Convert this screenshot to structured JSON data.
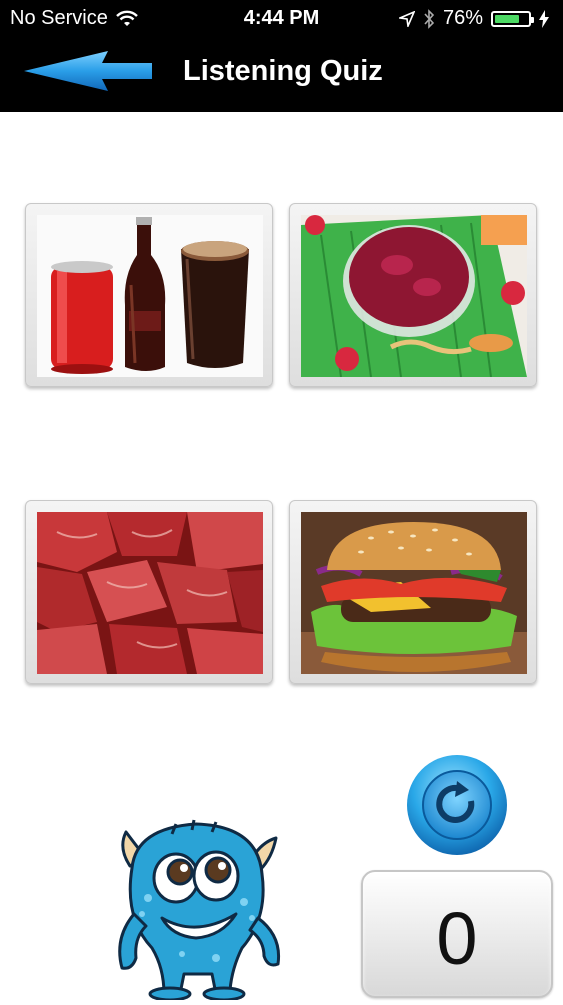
{
  "status_bar": {
    "carrier": "No Service",
    "time": "4:44 PM",
    "battery_percent": "76%",
    "battery_level": 0.76,
    "icons": [
      "wifi-icon",
      "location-arrow-icon",
      "bluetooth-icon",
      "battery-icon",
      "charging-bolt-icon"
    ]
  },
  "nav": {
    "title": "Listening Quiz",
    "back_icon": "back-arrow-icon"
  },
  "quiz_options": [
    {
      "name": "soda-drinks"
    },
    {
      "name": "berry-jam"
    },
    {
      "name": "raw-meat"
    },
    {
      "name": "hamburger"
    }
  ],
  "controls": {
    "replay_icon": "replay-icon",
    "score": "0"
  },
  "colors": {
    "accent_blue": "#2a9ee8",
    "battery_green": "#4cd964",
    "mascot_blue": "#2aa3d6"
  }
}
